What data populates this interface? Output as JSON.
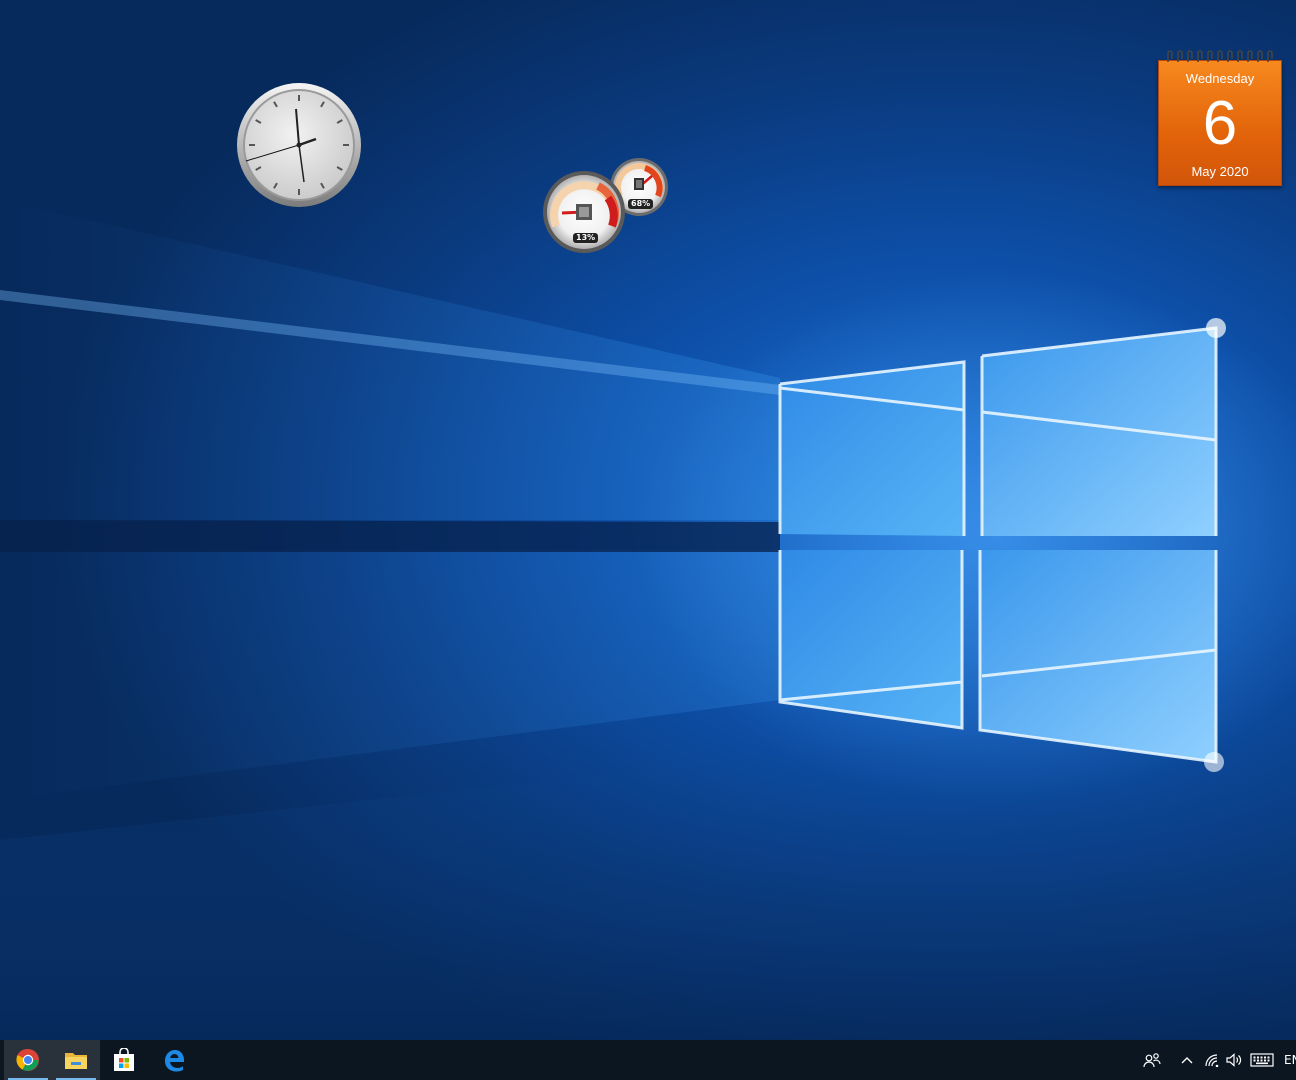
{
  "desktop": {
    "wallpaper": "windows-10-hero-light",
    "colors": {
      "base": "#0a3a7e",
      "glow": "#5ab0ff",
      "pane": "#3f9ff0"
    }
  },
  "gadgets": {
    "clock": {
      "icon": "analog-clock"
    },
    "meter": {
      "cpu_label": "13%",
      "memory_label": "68%",
      "cpu_value": 13,
      "memory_value": 68,
      "cpu_icon": "cpu-chip-icon",
      "memory_icon": "memory-chip-icon"
    },
    "calendar": {
      "day_name": "Wednesday",
      "day_number": "6",
      "month_year": "May 2020",
      "color": "#e2630a"
    }
  },
  "taskbar": {
    "background": "#0c1620",
    "apps": [
      {
        "name": "chrome",
        "icon": "chrome-icon",
        "active": true
      },
      {
        "name": "file-explorer",
        "icon": "folder-icon",
        "active": true
      },
      {
        "name": "microsoft-store",
        "icon": "store-bag-icon",
        "active": false
      },
      {
        "name": "edge",
        "icon": "edge-icon",
        "active": false
      }
    ],
    "tray": {
      "people_icon": "people-icon",
      "overflow_icon": "chevron-up-icon",
      "network_icon": "wifi-icon",
      "volume_icon": "speaker-icon",
      "keyboard_icon": "keyboard-icon",
      "language": "EN"
    }
  }
}
